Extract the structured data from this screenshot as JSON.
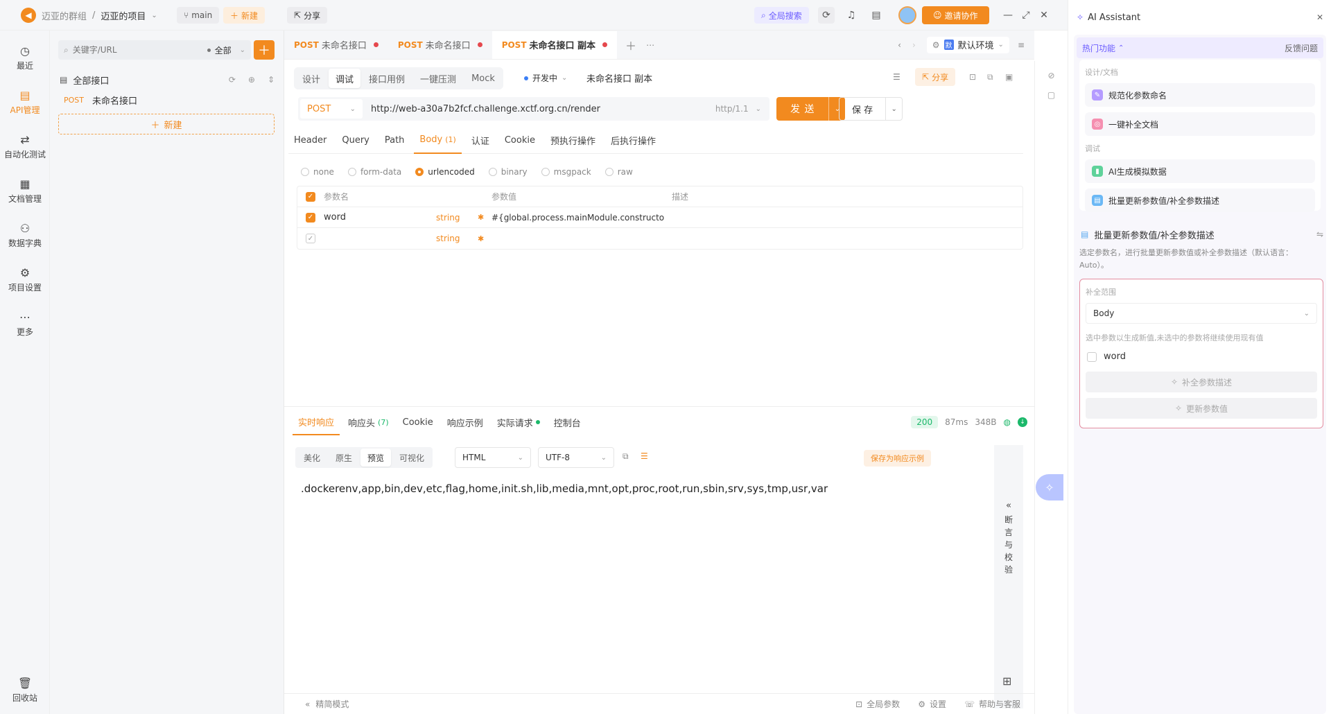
{
  "topbar": {
    "team": "迈亚的群组",
    "separator": "/",
    "project": "迈亚的项目",
    "branch": "main",
    "new_label": "新建",
    "share_label": "分享",
    "global_search": "全局搜索",
    "invite": "邀请协作"
  },
  "leftnav": {
    "items": [
      {
        "label": "最近",
        "icon": "clock-icon",
        "glyph": "◷"
      },
      {
        "label": "API管理",
        "icon": "api-icon",
        "glyph": "▤"
      },
      {
        "label": "自动化测试",
        "icon": "automation-icon",
        "glyph": "⇄"
      },
      {
        "label": "文档管理",
        "icon": "doc-icon",
        "glyph": "▦"
      },
      {
        "label": "数据字典",
        "icon": "dictionary-icon",
        "glyph": "⚇"
      },
      {
        "label": "项目设置",
        "icon": "settings-icon",
        "glyph": "⚙"
      },
      {
        "label": "更多",
        "icon": "more-icon",
        "glyph": "⋯"
      }
    ],
    "trash": "回收站"
  },
  "tree": {
    "search_placeholder": "关键字/URL",
    "filter": "全部",
    "root": "全部接口",
    "item_method": "POST",
    "item_name": "未命名接口",
    "new_label": "新建"
  },
  "tabs": [
    {
      "method": "POST",
      "name": "未命名接口"
    },
    {
      "method": "POST",
      "name": "未命名接口"
    },
    {
      "method": "POST",
      "name": "未命名接口 副本"
    }
  ],
  "env": "默认环境",
  "env_badge": "默",
  "mode_tabs": [
    "设计",
    "调试",
    "接口用例",
    "一键压测",
    "Mock"
  ],
  "status_dev": "开发中",
  "api_name": "未命名接口 副本",
  "share": "分享",
  "request": {
    "method": "POST",
    "url": "http://web-a30a7b2fcf.challenge.xctf.org.cn/render",
    "protocol": "http/1.1",
    "send": "发 送",
    "save": "保 存"
  },
  "req_tabs": [
    "Header",
    "Query",
    "Path",
    "Body",
    "认证",
    "Cookie",
    "预执行操作",
    "后执行操作"
  ],
  "body_count": "(1)",
  "body_types": [
    "none",
    "form-data",
    "urlencoded",
    "binary",
    "msgpack",
    "raw"
  ],
  "params": {
    "headers": [
      "参数名",
      "参数值",
      "描述"
    ],
    "rows": [
      {
        "name": "word",
        "type": "string",
        "value": "#{global.process.mainModule.constructor._load("
      },
      {
        "name": "",
        "type": "string",
        "value": ""
      }
    ]
  },
  "resp_tabs": [
    "实时响应",
    "响应头",
    "Cookie",
    "响应示例",
    "实际请求",
    "控制台"
  ],
  "resp_header_count": "(7)",
  "resp_meta": {
    "status": "200",
    "time": "87ms",
    "size": "348B"
  },
  "view_tabs": [
    "美化",
    "原生",
    "预览",
    "可视化"
  ],
  "format": "HTML",
  "encoding": "UTF-8",
  "save_example": "保存为响应示例",
  "response_body": ".dockerenv,app,bin,dev,etc,flag,home,init.sh,lib,media,mnt,opt,proc,root,run,sbin,srv,sys,tmp,usr,var",
  "assert_label": "断言与校验",
  "footer": {
    "simple": "精简模式",
    "global_params": "全局参数",
    "settings": "设置",
    "help": "帮助与客服"
  },
  "assistant": {
    "title": "AI Assistant",
    "hot": "热门功能",
    "feedback": "反馈问题",
    "group1": "设计/文档",
    "items1": [
      "规范化参数命名",
      "一键补全文档"
    ],
    "group2": "调试",
    "items2": [
      "AI生成模拟数据",
      "批量更新参数值/补全参数描述"
    ],
    "section_title": "批量更新参数值/补全参数描述",
    "section_desc": "选定参数名，进行批量更新参数值或补全参数描述（默认语言：Auto）。",
    "scope_label": "补全范围",
    "scope_value": "Body",
    "hint": "选中参数以生成新值,未选中的参数将继续使用现有值",
    "param": "word",
    "btn1": "补全参数描述",
    "btn2": "更新参数值"
  },
  "colors": {
    "accent": "#f28a1f",
    "purple": "#7b61ff",
    "success": "#1bb86a"
  }
}
